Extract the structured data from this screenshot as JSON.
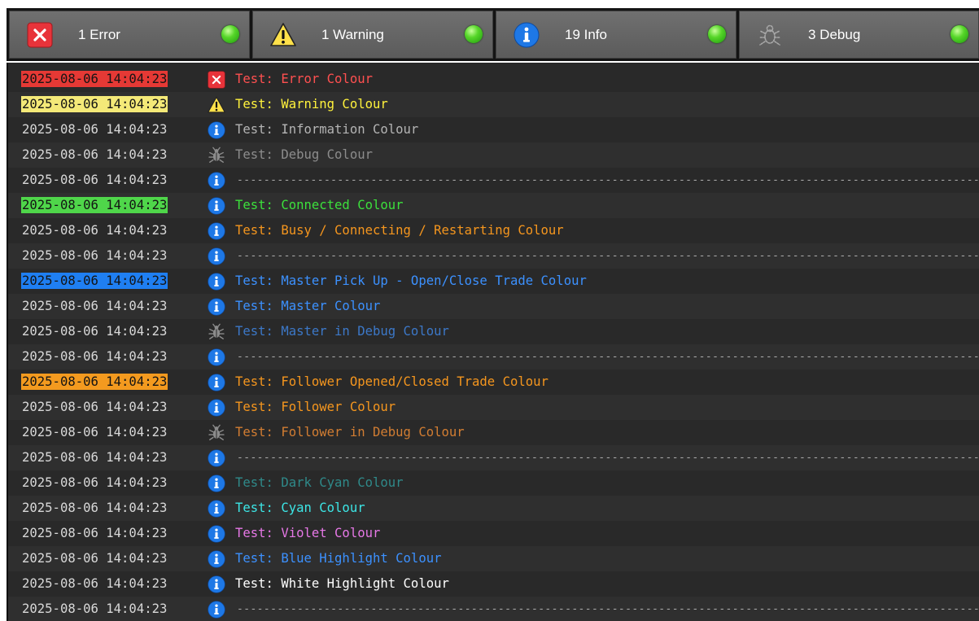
{
  "colors": {
    "error": "#ff5050",
    "warning": "#fff23c",
    "info": "#b4b4b4",
    "debug": "#8c8c8c",
    "connected": "#3ce03c",
    "busy": "#f5961e",
    "master": "#3c91ff",
    "master_debug": "#3c78c8",
    "follower": "#f5961e",
    "follower_debug": "#d27d32",
    "dark_cyan": "#2f8a8a",
    "cyan": "#3ce6e6",
    "violet": "#e678e6",
    "blue_highlight": "#3c91ff",
    "white_highlight": "#ffffff",
    "led_green": "#3cc828"
  },
  "filters": [
    {
      "icon": "error-icon",
      "label": "1 Error",
      "status": "enabled"
    },
    {
      "icon": "warning-icon",
      "label": "1 Warning",
      "status": "enabled"
    },
    {
      "icon": "info-icon",
      "label": "19 Info",
      "status": "enabled"
    },
    {
      "icon": "bug-icon",
      "label": "3 Debug",
      "status": "enabled"
    }
  ],
  "log": [
    {
      "ts": "2025-08-06 14:04:23",
      "icon": "error-icon",
      "msg": "Test: Error Colour",
      "color": "#ff5050",
      "hl": "error"
    },
    {
      "ts": "2025-08-06 14:04:23",
      "icon": "warning-icon",
      "msg": "Test: Warning Colour",
      "color": "#fff23c",
      "hl": "warning"
    },
    {
      "ts": "2025-08-06 14:04:23",
      "icon": "info-icon",
      "msg": "Test: Information Colour",
      "color": "#b4b4b4"
    },
    {
      "ts": "2025-08-06 14:04:23",
      "icon": "bug-icon",
      "msg": "Test: Debug Colour",
      "color": "#8c8c8c"
    },
    {
      "ts": "2025-08-06 14:04:23",
      "icon": "info-icon",
      "msg": "------------------------------------------------------------------------------------------------------------------------------------------------",
      "color": "#a8a8a8",
      "sep": true
    },
    {
      "ts": "2025-08-06 14:04:23",
      "icon": "info-icon",
      "msg": "Test: Connected Colour",
      "color": "#3ce03c",
      "hl": "connected"
    },
    {
      "ts": "2025-08-06 14:04:23",
      "icon": "info-icon",
      "msg": "Test: Busy / Connecting / Restarting Colour",
      "color": "#f5961e"
    },
    {
      "ts": "2025-08-06 14:04:23",
      "icon": "info-icon",
      "msg": "------------------------------------------------------------------------------------------------------------------------------------------------",
      "color": "#a8a8a8",
      "sep": true
    },
    {
      "ts": "2025-08-06 14:04:23",
      "icon": "info-icon",
      "msg": "Test: Master Pick Up - Open/Close Trade Colour",
      "color": "#3c91ff",
      "hl": "master"
    },
    {
      "ts": "2025-08-06 14:04:23",
      "icon": "info-icon",
      "msg": "Test: Master Colour",
      "color": "#3c91ff"
    },
    {
      "ts": "2025-08-06 14:04:23",
      "icon": "bug-icon",
      "msg": "Test: Master in Debug Colour",
      "color": "#3c78c8"
    },
    {
      "ts": "2025-08-06 14:04:23",
      "icon": "info-icon",
      "msg": "------------------------------------------------------------------------------------------------------------------------------------------------",
      "color": "#a8a8a8",
      "sep": true
    },
    {
      "ts": "2025-08-06 14:04:23",
      "icon": "info-icon",
      "msg": "Test: Follower Opened/Closed Trade Colour",
      "color": "#f5961e",
      "hl": "follower"
    },
    {
      "ts": "2025-08-06 14:04:23",
      "icon": "info-icon",
      "msg": "Test: Follower Colour",
      "color": "#f5961e"
    },
    {
      "ts": "2025-08-06 14:04:23",
      "icon": "bug-icon",
      "msg": "Test: Follower in Debug Colour",
      "color": "#d27d32"
    },
    {
      "ts": "2025-08-06 14:04:23",
      "icon": "info-icon",
      "msg": "------------------------------------------------------------------------------------------------------------------------------------------------",
      "color": "#a8a8a8",
      "sep": true
    },
    {
      "ts": "2025-08-06 14:04:23",
      "icon": "info-icon",
      "msg": "Test: Dark Cyan Colour",
      "color": "#2f8a8a"
    },
    {
      "ts": "2025-08-06 14:04:23",
      "icon": "info-icon",
      "msg": "Test: Cyan Colour",
      "color": "#3ce6e6"
    },
    {
      "ts": "2025-08-06 14:04:23",
      "icon": "info-icon",
      "msg": "Test: Violet Colour",
      "color": "#e678e6"
    },
    {
      "ts": "2025-08-06 14:04:23",
      "icon": "info-icon",
      "msg": "Test: Blue Highlight Colour",
      "color": "#3c91ff"
    },
    {
      "ts": "2025-08-06 14:04:23",
      "icon": "info-icon",
      "msg": "Test: White Highlight Colour",
      "color": "#ffffff"
    },
    {
      "ts": "2025-08-06 14:04:23",
      "icon": "info-icon",
      "msg": "------------------------------------------------------------------------------------------------------------------------------------------------",
      "color": "#a8a8a8",
      "sep": true
    }
  ]
}
